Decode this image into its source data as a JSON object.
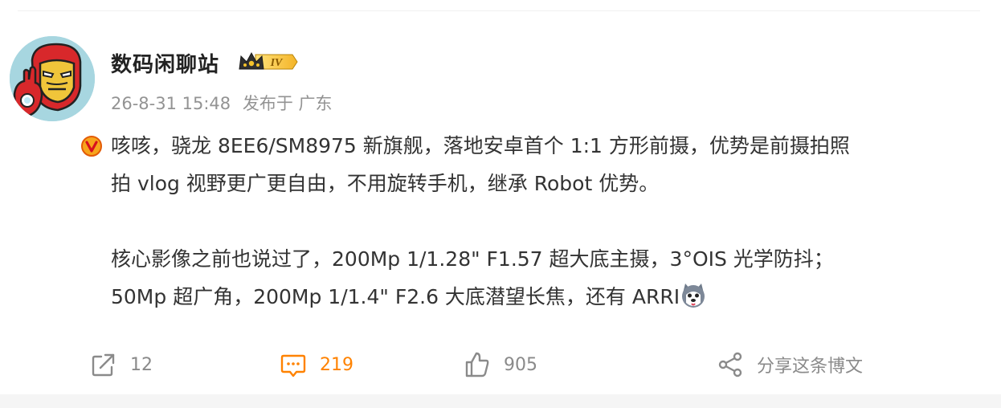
{
  "post": {
    "author": {
      "name": "数码闲聊站",
      "level_label": "IV",
      "avatar_icon": "iron-man-avatar",
      "verified_icon": "verified-v-badge"
    },
    "meta": {
      "timestamp": "26-8-31 15:48",
      "location": "发布于 广东"
    },
    "content": {
      "para1_line1": "咳咳，骁龙 8EE6/SM8975 新旗舰，落地安卓首个 1:1 方形前摄，优势是前摄拍照",
      "para1_line2": "拍 vlog 视野更广更自由，不用旋转手机，继承 Robot 优势。",
      "para2_line1": "核心影像之前也说过了，200Mp 1/1.28\" F1.57 超大底主摄，3°OIS 光学防抖；",
      "para2_line2": "50Mp 超广角，200Mp 1/1.4\" F2.6 大底潜望长焦，还有 ARRI",
      "emoji_icon": "husky-dog-emoji"
    },
    "actions": {
      "repost_count": "12",
      "comment_count": "219",
      "like_count": "905",
      "share_label": "分享这条博文"
    }
  },
  "colors": {
    "accent": "#ff8200",
    "meta_gray": "#939393",
    "icon_gray": "#8a8a8a"
  }
}
